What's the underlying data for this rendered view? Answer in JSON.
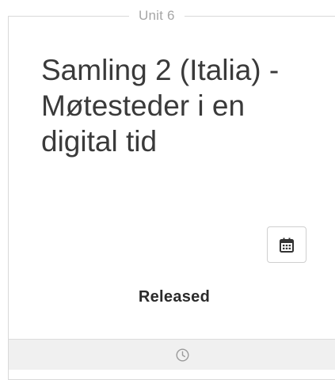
{
  "unit": {
    "label": "Unit 6"
  },
  "lesson": {
    "title": "Samling 2 (Italia) - Møtesteder i en digital tid"
  },
  "status": {
    "label": "Released"
  },
  "icons": {
    "calendar": "calendar-icon",
    "clock": "clock-icon"
  },
  "colors": {
    "title": "#3a3a3a",
    "muted": "#a6a6a6",
    "border": "#d9d9d9",
    "footer_bg": "#f0f0f0"
  }
}
